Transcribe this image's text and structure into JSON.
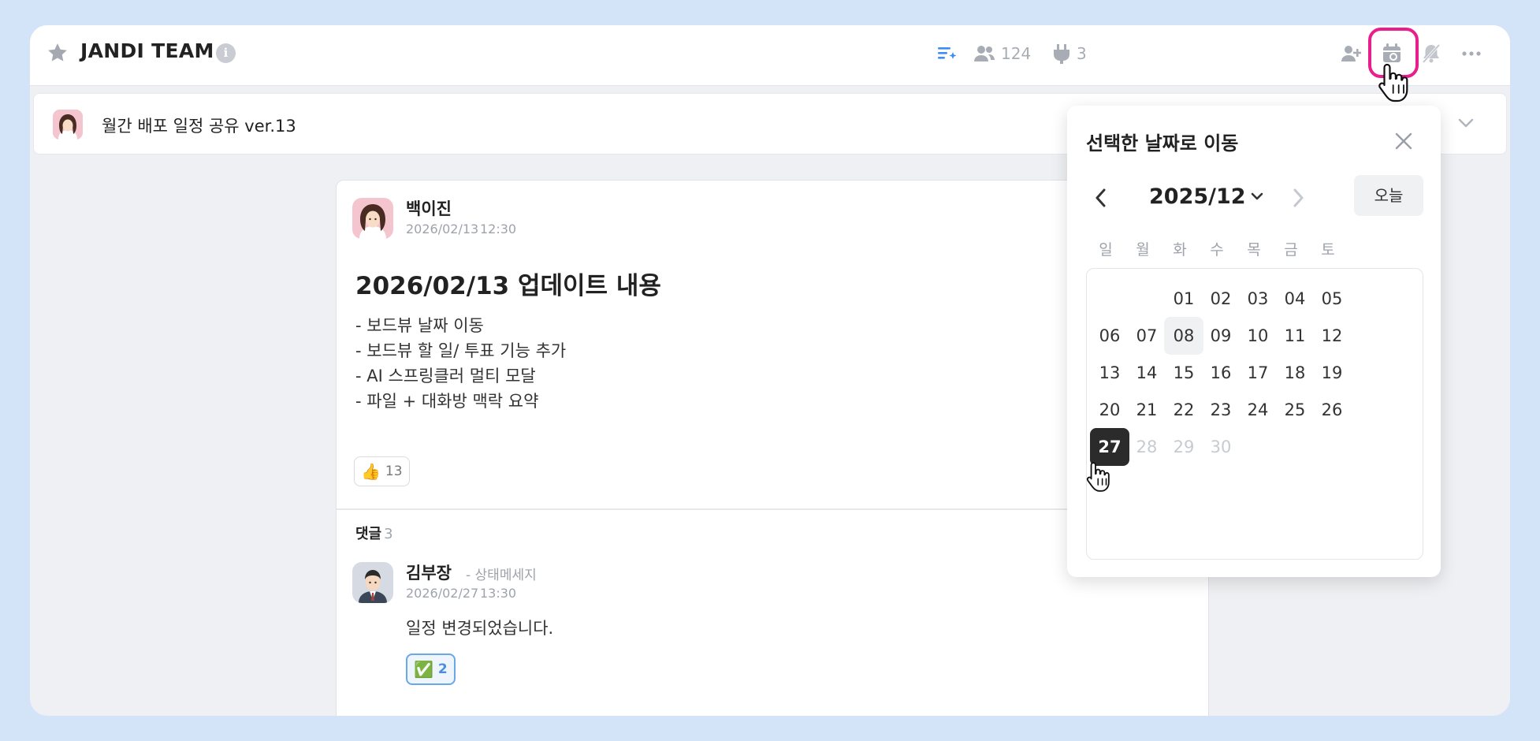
{
  "topbar": {
    "team_name": "JANDI TEAM",
    "info_icon": "i",
    "members_count": "124",
    "integrations_count": "3"
  },
  "announcement": {
    "text": "월간 배포 일정 공유 ver.13"
  },
  "message": {
    "author": "백이진",
    "date": "2026/02/13",
    "time": "12:30",
    "title": "2026/02/13 업데이트 내용",
    "lines": [
      "- 보드뷰 날짜 이동",
      "- 보드뷰 할 일/ 투표 기능 추가",
      "- AI 스프링클러 멀티 모달",
      "- 파일 + 대화방 맥락 요약"
    ],
    "reaction_emoji": "👍",
    "reaction_count": "13"
  },
  "comments": {
    "label": "댓글",
    "count": "3",
    "items": [
      {
        "author": "김부장",
        "status": "- 상태메세지",
        "date": "2026/02/27",
        "time": "13:30",
        "text": "일정 변경되었습니다.",
        "reaction_emoji": "✅",
        "reaction_count": "2"
      }
    ]
  },
  "date_popup": {
    "title": "선택한 날짜로 이동",
    "month_label": "2025/12",
    "today_label": "오늘",
    "weekdays": [
      "일",
      "월",
      "화",
      "수",
      "목",
      "금",
      "토"
    ],
    "days": [
      "01",
      "02",
      "03",
      "04",
      "05",
      "06",
      "07",
      "08",
      "09",
      "10",
      "11",
      "12",
      "13",
      "14",
      "15",
      "16",
      "17",
      "18",
      "19",
      "20",
      "21",
      "22",
      "23",
      "24",
      "25",
      "26",
      "27",
      "28",
      "29",
      "30"
    ],
    "selected_day": "27",
    "hovered_day": "08",
    "disabled_days": [
      "28",
      "29",
      "30"
    ],
    "first_weekday_index": 2
  },
  "colors": {
    "highlight": "#e91e8c",
    "background": "#d3e3f8",
    "ai_icon": "#3d8ef0",
    "selected_day_bg": "#2b2b2b"
  },
  "icons": [
    "star-icon",
    "info-icon",
    "ai-summary-icon",
    "members-icon",
    "integrations-icon",
    "add-member-icon",
    "calendar-search-icon",
    "notification-off-icon",
    "more-icon",
    "chevron-down-icon",
    "close-icon",
    "chevron-left-icon",
    "chevron-right-icon",
    "hand-cursor-icon"
  ]
}
